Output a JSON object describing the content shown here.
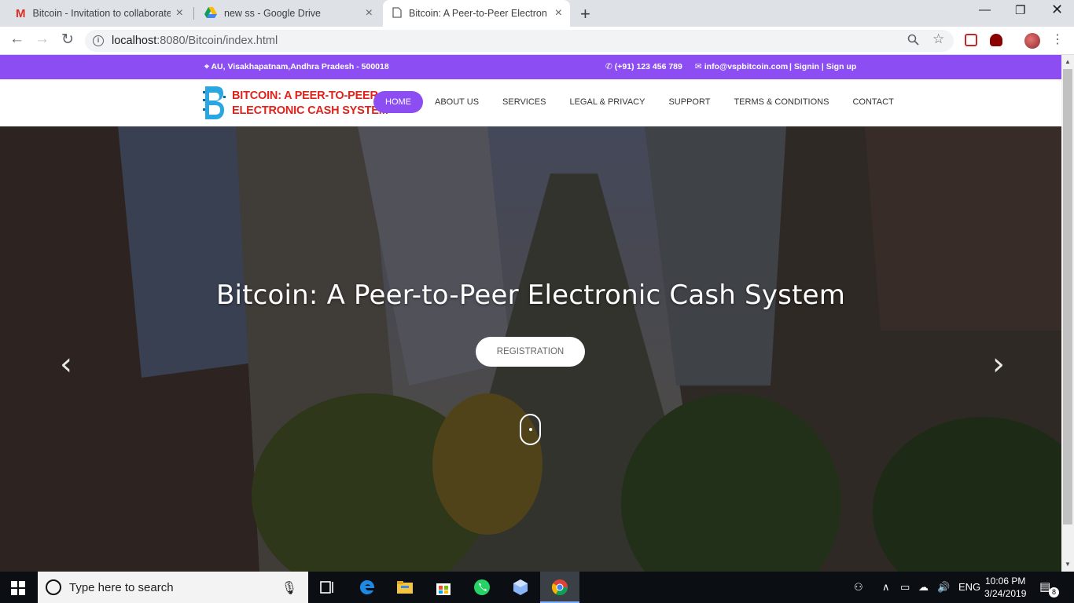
{
  "browser": {
    "tabs": [
      {
        "title": "Bitcoin - Invitation to collaborate",
        "icon": "gmail-icon",
        "active": false
      },
      {
        "title": "new ss - Google Drive",
        "icon": "google-drive-icon",
        "active": false
      },
      {
        "title": "Bitcoin: A Peer-to-Peer Electronic",
        "icon": "page-icon",
        "active": true
      }
    ],
    "url_host": "localhost",
    "url_rest": ":8080/Bitcoin/index.html"
  },
  "topbar": {
    "address": "AU, Visakhapatnam,Andhra Pradesh - 500018",
    "phone": "(+91) 123 456 789",
    "email": "info@vspbitcoin.com",
    "signin": "Signin",
    "signup": "Sign up"
  },
  "header": {
    "logo_line1": "BITCOIN: A PEER-TO-PEER",
    "logo_line2": "ELECTRONIC CASH SYSTEM",
    "nav": [
      "HOME",
      "ABOUT US",
      "SERVICES",
      "LEGAL & PRIVACY",
      "SUPPORT",
      "TERMS & CONDITIONS",
      "CONTACT"
    ],
    "active_index": 0
  },
  "hero": {
    "title": "Bitcoin: A Peer-to-Peer Electronic Cash System",
    "button": "REGISTRATION",
    "prev_glyph": "‹",
    "next_glyph": "›"
  },
  "taskbar": {
    "search_placeholder": "Type here to search",
    "language": "ENG",
    "time": "10:06 PM",
    "date": "3/24/2019",
    "notification_count": "8"
  },
  "colors": {
    "accent": "#8c4ef2",
    "logo_red": "#e0221b"
  }
}
